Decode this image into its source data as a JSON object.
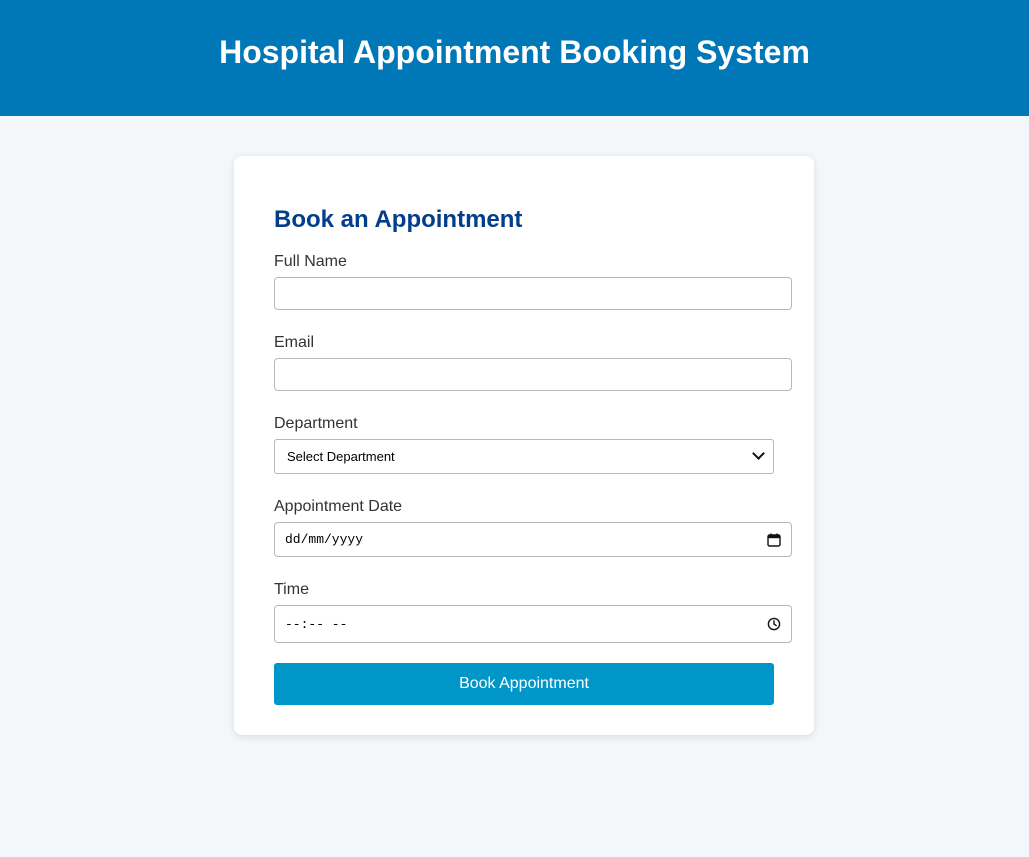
{
  "header": {
    "title": "Hospital Appointment Booking System"
  },
  "form": {
    "heading": "Book an Appointment",
    "full_name": {
      "label": "Full Name",
      "value": ""
    },
    "email": {
      "label": "Email",
      "value": ""
    },
    "department": {
      "label": "Department",
      "selected": "Select Department"
    },
    "date": {
      "label": "Appointment Date",
      "placeholder": "dd/mm/yyyy",
      "icon": "calendar-icon"
    },
    "time": {
      "label": "Time",
      "placeholder": "--:-- --",
      "icon": "clock-icon"
    },
    "submit_label": "Book Appointment"
  },
  "colors": {
    "header_bg": "#0077b6",
    "heading": "#023e8a",
    "button_bg": "#0096c7",
    "page_bg": "#f3f7fa"
  }
}
